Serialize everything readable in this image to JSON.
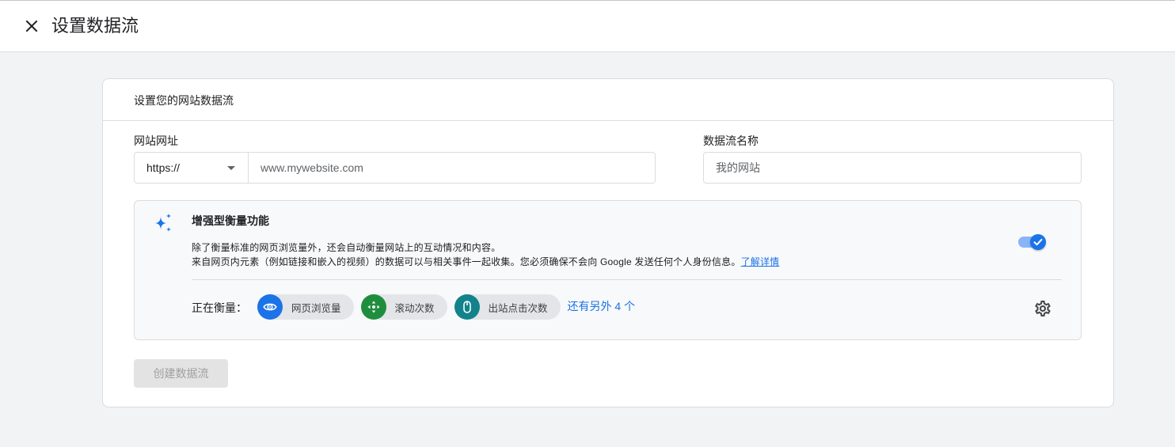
{
  "header": {
    "title": "设置数据流",
    "close_icon": "close-icon"
  },
  "card": {
    "title": "设置您的网站数据流"
  },
  "url_field": {
    "label": "网站网址",
    "protocol": "https://",
    "placeholder": "www.mywebsite.com"
  },
  "name_field": {
    "label": "数据流名称",
    "placeholder": "我的网站"
  },
  "enhanced": {
    "icon": "sparkle-icon",
    "title": "增强型衡量功能",
    "description_line1": "除了衡量标准的网页浏览量外，还会自动衡量网站上的互动情况和内容。",
    "description_line2": "来自网页内元素（例如链接和嵌入的视频）的数据可以与相关事件一起收集。您必须确保不会向 Google 发送任何个人身份信息。",
    "learn_more": "了解详情",
    "toggle_on": true,
    "measuring_label": "正在衡量：",
    "chips": [
      {
        "label": "网页浏览量",
        "icon": "eye-icon",
        "color": "#1a73e8"
      },
      {
        "label": "滚动次数",
        "icon": "scroll-icon",
        "color": "#1e8e3e"
      },
      {
        "label": "出站点击次数",
        "icon": "mouse-icon",
        "color": "#12828b"
      }
    ],
    "more_link": "还有另外 4 个",
    "settings_icon": "gear-icon"
  },
  "create_button": {
    "label": "创建数据流",
    "disabled": true
  },
  "colors": {
    "accent": "#1a73e8",
    "accent_light": "#8ab4f8",
    "page_background": "#f1f3f4",
    "panel_background": "#f8f9fa",
    "border": "#dadce0"
  }
}
